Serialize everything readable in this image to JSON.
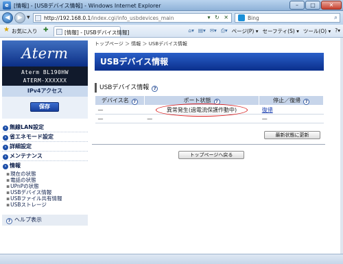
{
  "window": {
    "title": "[情報] - [USBデバイス情報] - Windows Internet Explorer",
    "minimize": "–",
    "maximize": "□",
    "close": "✕"
  },
  "address_bar": {
    "url_main": "http://192.168.0.1",
    "url_rest": "/index.cgi/info_usbdevices_main",
    "search_placeholder": "Bing"
  },
  "favorites_bar": {
    "favorites_label": "お気に入り",
    "tab_label": "[情報] - [USBデバイス情報]",
    "commands": [
      "ページ(P) ▾",
      "セーフティ(S) ▾",
      "ツール(O) ▾",
      "?▾"
    ]
  },
  "sidebar": {
    "logo": "Aterm",
    "model_line1": "Aterm BL190HW",
    "model_line2": "ATERM-XXXXXX",
    "access_mode": "IPv4アクセス",
    "save_label": "保存",
    "menu": [
      {
        "label": "無線LAN設定"
      },
      {
        "label": "省エネモード設定"
      },
      {
        "label": "詳細設定"
      },
      {
        "label": "メンテナンス"
      },
      {
        "label": "情報"
      }
    ],
    "submenu": [
      {
        "label": "現在の状態"
      },
      {
        "label": "電話の状態"
      },
      {
        "label": "UPnPの状態"
      },
      {
        "label": "USBデバイス情報"
      },
      {
        "label": "USBファイル共有情報"
      },
      {
        "label": "USBストレージ"
      }
    ],
    "help_label": "ヘルプ表示"
  },
  "main": {
    "breadcrumb": "トップページ ＞ 情報 ＞ USBデバイス情報",
    "page_title": "USBデバイス情報",
    "section_title": "USBデバイス情報",
    "help_glyph": "?",
    "table": {
      "headers": [
        "デバイス名",
        "ポート状態",
        "停止／復帰"
      ],
      "rows": [
        {
          "device": "—",
          "port": "異常発生(過電流保護作動中)",
          "action": "復帰"
        },
        {
          "device": "—",
          "port": "—",
          "action": "—"
        }
      ]
    },
    "refresh_button": "最新状態に更新",
    "top_button": "トップページへ戻る"
  },
  "colors": {
    "banner": "#0a2f8c",
    "error_circle": "#d81818",
    "table_header": "#c7d5ea"
  }
}
